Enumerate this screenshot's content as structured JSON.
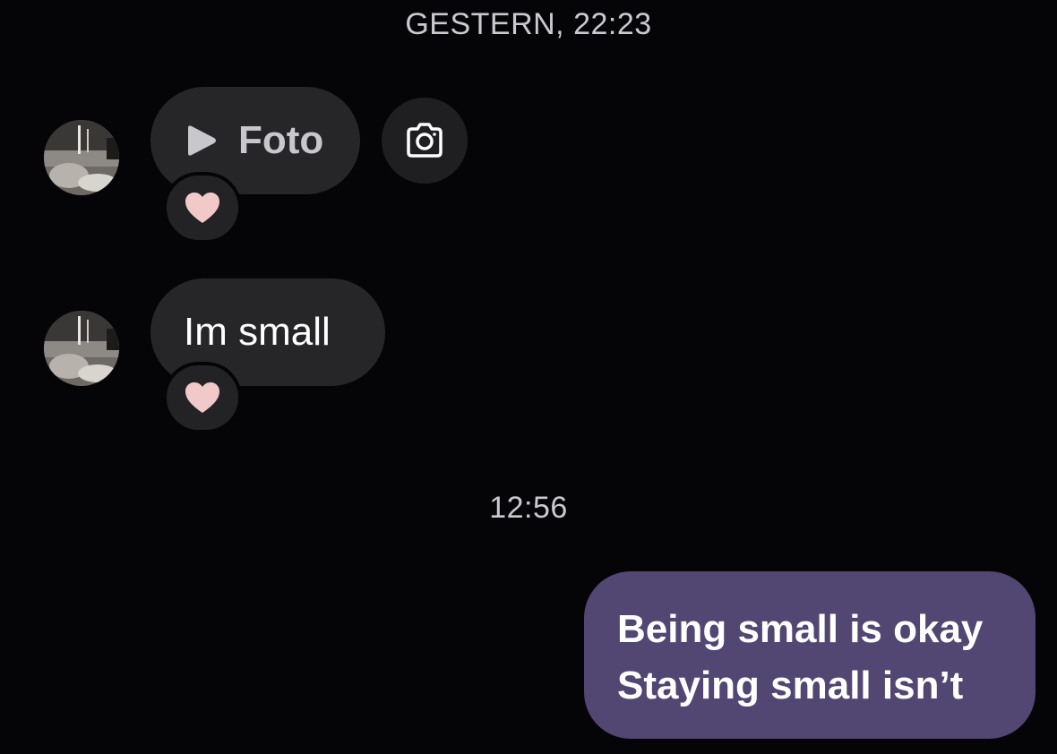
{
  "timestamps": {
    "first": "GESTERN, 22:23",
    "second": "12:56"
  },
  "messages": [
    {
      "sender": "other",
      "type": "photo",
      "label": "Foto",
      "reaction": "heart"
    },
    {
      "sender": "other",
      "type": "text",
      "text": "Im small",
      "reaction": "heart"
    },
    {
      "sender": "me",
      "type": "text",
      "lines": [
        "Being small is okay",
        "Staying small isn’t"
      ]
    }
  ],
  "icons": {
    "play": "play-icon",
    "camera": "camera-icon",
    "reaction": "heart-icon"
  },
  "colors": {
    "background": "#050507",
    "incoming_bubble": "#262629",
    "outgoing_bubble": "#524672",
    "reaction_heart": "#f2c9c9"
  }
}
